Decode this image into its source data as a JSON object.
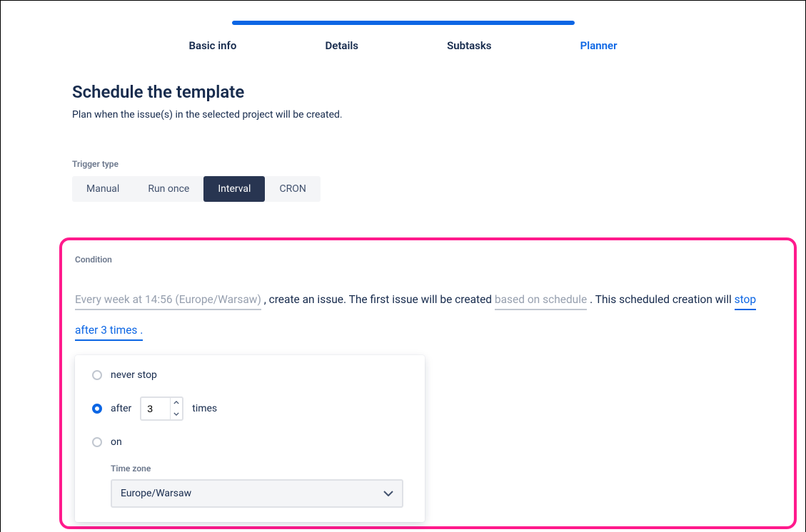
{
  "stepper": {
    "tabs": [
      "Basic info",
      "Details",
      "Subtasks",
      "Planner"
    ],
    "active_index": 3
  },
  "heading": {
    "title": "Schedule the template",
    "subtitle": "Plan when the issue(s) in the selected project will be created."
  },
  "trigger": {
    "label": "Trigger type",
    "options": [
      "Manual",
      "Run once",
      "Interval",
      "CRON"
    ],
    "active_index": 2
  },
  "condition": {
    "label": "Condition",
    "seg_schedule": "Every week at 14:56 (Europe/Warsaw)",
    "seg_text1": " , create an issue. The first issue will be created ",
    "seg_based": "based on schedule",
    "seg_text2": " . This scheduled creation will ",
    "seg_stop": "stop after 3 times .",
    "popover": {
      "opt_never": "never stop",
      "opt_after_prefix": "after",
      "opt_after_value": "3",
      "opt_after_suffix": "times",
      "opt_on": "on",
      "tz_label": "Time zone",
      "tz_value": "Europe/Warsaw",
      "selected": "after"
    }
  }
}
